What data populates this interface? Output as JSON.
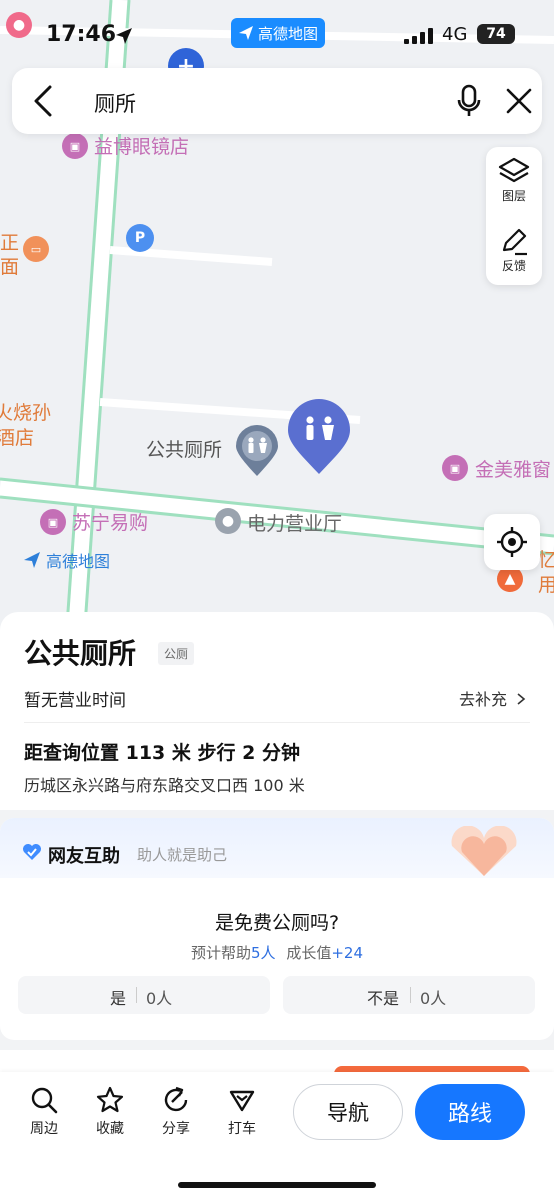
{
  "status_bar": {
    "time": "17:46",
    "app_badge": "高德地图",
    "network": "4G",
    "battery": "74"
  },
  "search": {
    "query": "厕所"
  },
  "map": {
    "labels": {
      "shop1": "益博眼镜店",
      "left_top1": "正",
      "left_top2": "面",
      "left_mid1": "火烧孙",
      "left_mid2": "酒店",
      "toilet_label": "公共厕所",
      "store1": "金美雅窗",
      "store2": "苏宁易购",
      "office": "电力营业厅",
      "right_edge1": "忆",
      "right_edge2": "用"
    },
    "watermark": "高德地图",
    "tools": {
      "layers": "图层",
      "feedback": "反馈"
    }
  },
  "place": {
    "name": "公共厕所",
    "tag": "公厕",
    "hours": "暂无营业时间",
    "supplement": "去补充",
    "distance": "距查询位置 113 米  步行 2 分钟",
    "address": "历城区永兴路与府东路交叉口西 100 米"
  },
  "community": {
    "title": "网友互助",
    "subtitle": "助人就是助己",
    "question": "是免费公厕吗?",
    "help_prefix": "预计帮助",
    "help_count": "5人",
    "growth_prefix": "成长值",
    "growth_value": "+24",
    "yes_label": "是",
    "yes_count": "0人",
    "no_label": "不是",
    "no_count": "0人"
  },
  "bottom_bar": {
    "nearby": "周边",
    "favorite": "收藏",
    "share": "分享",
    "taxi": "打车",
    "navigate": "导航",
    "route": "路线"
  },
  "colors": {
    "accent": "#1677ff",
    "road": "#9fe0bf",
    "poi_purple": "#c46fb6",
    "pin_blue": "#5a6fd0"
  }
}
